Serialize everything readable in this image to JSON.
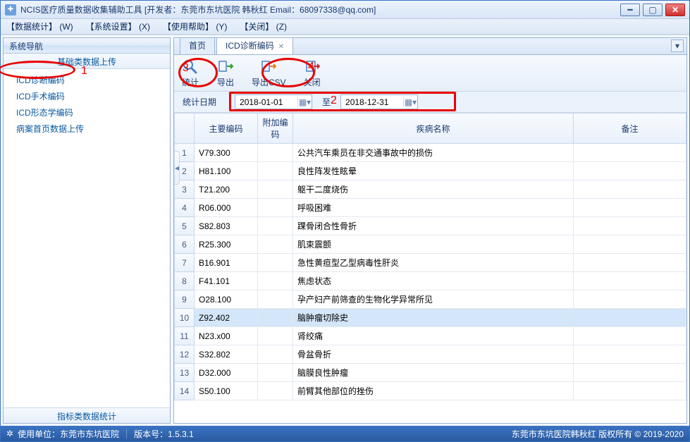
{
  "window": {
    "title": "NCIS医疗质量数据收集辅助工具   [开发者：东莞市东坑医院 韩秋红 Email：68097338@qq.com]"
  },
  "menu": {
    "m1": "【数据统计】 (W)",
    "m2": "【系统设置】 (X)",
    "m3": "【使用帮助】 (Y)",
    "m4": "【关闭】 (Z)"
  },
  "sidebar": {
    "header": "系统导航",
    "groupTop": "基础类数据上传",
    "groupBottom": "指标类数据统计",
    "items": {
      "icd_dx": "ICD诊断编码",
      "icd_op": "ICD手术编码",
      "icd_morph": "ICD形态学编码",
      "front_upload": "病案首页数据上传"
    }
  },
  "tabs": {
    "home": "首页",
    "icd": "ICD诊断编码"
  },
  "toolbar": {
    "stat": "统计",
    "export": "导出",
    "exportcsv": "导出CSV",
    "close": "关闭"
  },
  "filter": {
    "label": "统计日期",
    "from": "2018-01-01",
    "to_lbl": "至",
    "to": "2018-12-31"
  },
  "annotations": {
    "a1": "1",
    "a2": "2",
    "a3": "3",
    "a4": "4"
  },
  "grid": {
    "headers": {
      "blank": "",
      "code": "主要编码",
      "addl": "附加编码",
      "disease": "疾病名称",
      "remark": "备注"
    },
    "rows": [
      {
        "n": "1",
        "code": "V79.300",
        "name": "公共汽车乘员在非交通事故中的损伤"
      },
      {
        "n": "2",
        "code": "H81.100",
        "name": "良性阵发性眩晕"
      },
      {
        "n": "3",
        "code": "T21.200",
        "name": "躯干二度烧伤"
      },
      {
        "n": "4",
        "code": "R06.000",
        "name": "呼吸困难"
      },
      {
        "n": "5",
        "code": "S82.803",
        "name": "踝骨闭合性骨折"
      },
      {
        "n": "6",
        "code": "R25.300",
        "name": "肌束震颤"
      },
      {
        "n": "7",
        "code": "B16.901",
        "name": "急性黄疸型乙型病毒性肝炎"
      },
      {
        "n": "8",
        "code": "F41.101",
        "name": "焦虑状态"
      },
      {
        "n": "9",
        "code": "O28.100",
        "name": "孕产妇产前筛查的生物化学异常所见"
      },
      {
        "n": "10",
        "code": "Z92.402",
        "name": "脑肿瘤切除史",
        "sel": true
      },
      {
        "n": "11",
        "code": "N23.x00",
        "name": "肾绞痛"
      },
      {
        "n": "12",
        "code": "S32.802",
        "name": "骨盆骨折"
      },
      {
        "n": "13",
        "code": "D32.000",
        "name": "脑膜良性肿瘤"
      },
      {
        "n": "14",
        "code": "S50.100",
        "name": "前臂其他部位的挫伤"
      }
    ]
  },
  "status": {
    "left_icon_label": "使用单位：东莞市东坑医院",
    "version_label": "版本号：1.5.3.1",
    "right": "东莞市东坑医院韩秋红  版权所有  © 2019-2020"
  }
}
